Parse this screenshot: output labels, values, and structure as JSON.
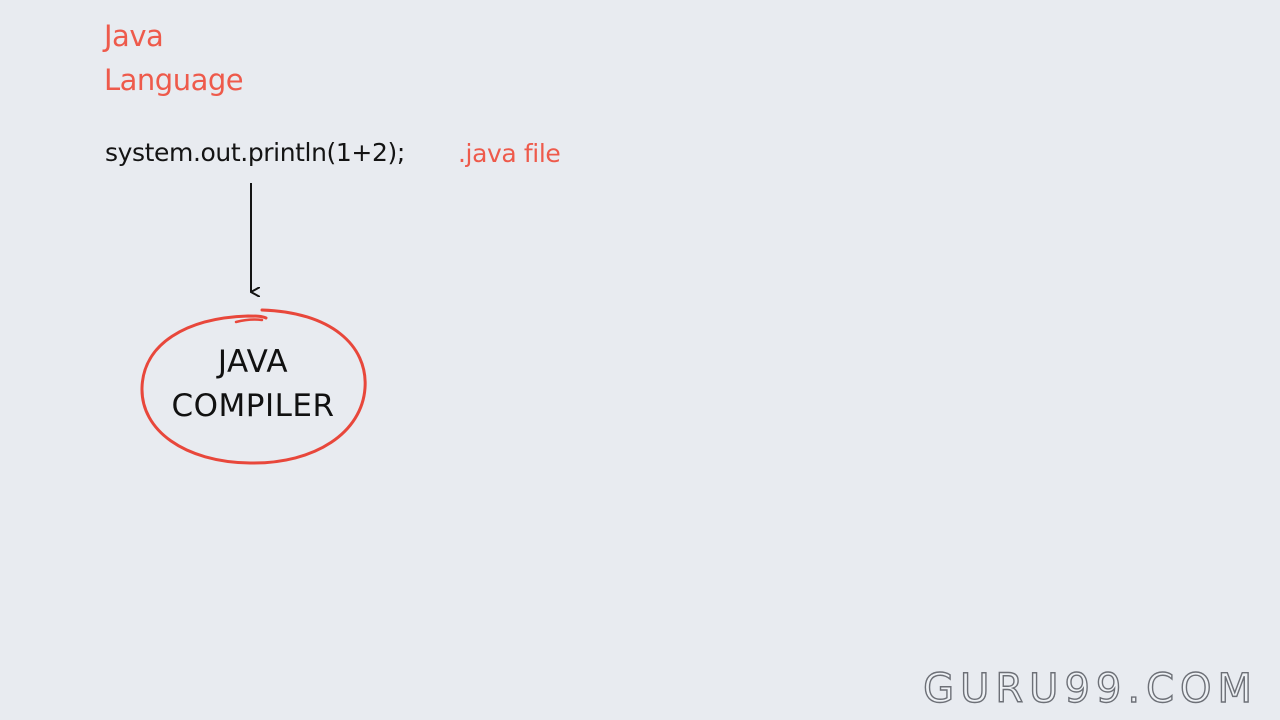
{
  "title": {
    "line1": "Java",
    "line2": "Language"
  },
  "code_statement": "system.out.println(1+2);",
  "file_label": ".java file",
  "compiler": {
    "line1": "JAVA",
    "line2": "COMPILER"
  },
  "watermark": "GURU99.COM",
  "colors": {
    "background": "#e8ebf0",
    "accent_red": "#ee5a4b",
    "ink": "#141414"
  }
}
